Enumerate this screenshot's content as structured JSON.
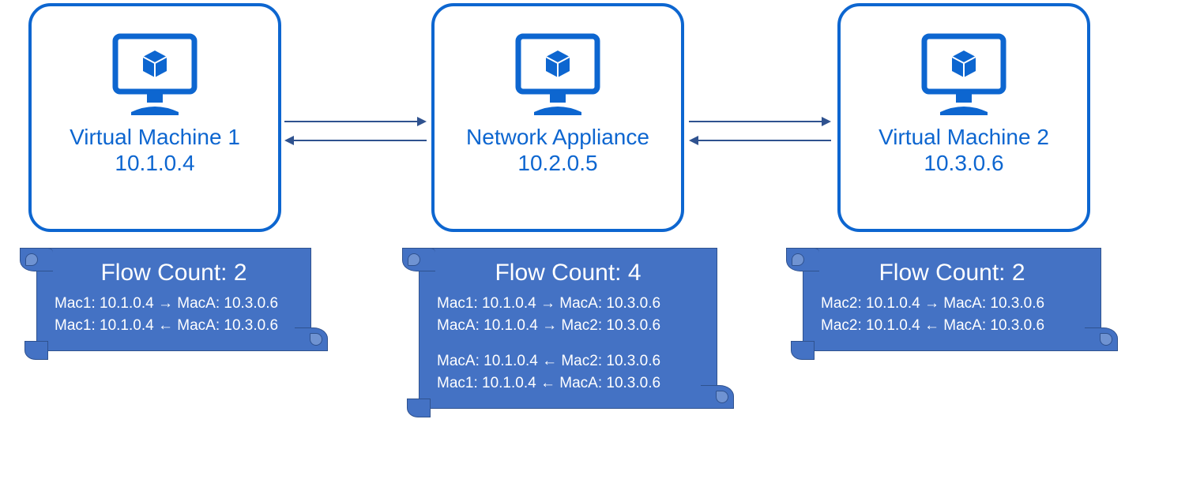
{
  "nodes": {
    "vm1": {
      "title": "Virtual Machine 1",
      "ip": "10.1.0.4"
    },
    "appliance": {
      "title": "Network Appliance",
      "ip": "10.2.0.5"
    },
    "vm2": {
      "title": "Virtual Machine 2",
      "ip": "10.3.0.6"
    }
  },
  "scrolls": {
    "vm1": {
      "title": "Flow Count: 2",
      "lines": [
        "Mac1: 10.1.0.4 → MacA: 10.3.0.6",
        "Mac1: 10.1.0.4 ← MacA: 10.3.0.6"
      ]
    },
    "appliance": {
      "title": "Flow Count: 4",
      "lines_a": [
        "Mac1: 10.1.0.4 → MacA: 10.3.0.6",
        "MacA: 10.1.0.4 → Mac2: 10.3.0.6"
      ],
      "lines_b": [
        "MacA: 10.1.0.4 ← Mac2: 10.3.0.6",
        "Mac1: 10.1.0.4 ← MacA: 10.3.0.6"
      ]
    },
    "vm2": {
      "title": "Flow Count: 2",
      "lines": [
        "Mac2: 10.1.0.4 → MacA: 10.3.0.6",
        "Mac2: 10.1.0.4 ← MacA: 10.3.0.6"
      ]
    }
  },
  "colors": {
    "azure_blue": "#0d66d0",
    "scroll_fill": "#4472c4",
    "scroll_border": "#2f528f",
    "arrow": "#2f528f"
  }
}
